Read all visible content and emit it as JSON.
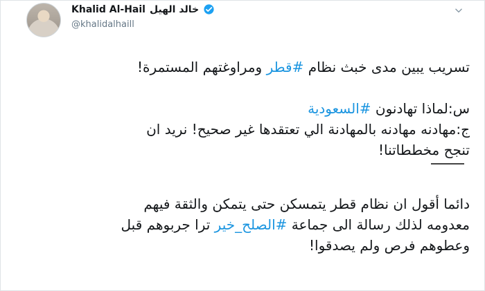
{
  "tweet": {
    "display_name": "Khalid Al-Hail",
    "arabic_name": "خالد الهيل",
    "handle": "@khalidalhaill",
    "verified_icon": "verified-badge-icon",
    "more_icon": "chevron-down-icon",
    "line1_pre": "تسريب يبين مدى خبث نظام ",
    "line1_tag": "#قطر",
    "line1_post": " ومراوغتهم المستمرة!",
    "q_pre": "س:لماذا تهادنون ",
    "q_tag": "#السعودية",
    "a_line1": "ج:مهادنه مهادنه بالمهادنة الي تعتقدها غير صحيح! نريد ان",
    "a_line2": "تنجح مخططاتنا!",
    "p3_line1": "دائما أقول ان نظام قطر يتمسكن حتى يتمكن والثقة فيهم",
    "p3_line2_pre": "معدومه لذلك رسالة الى جماعة ",
    "p3_tag": "#الصلح_خير",
    "p3_line2_post": " ترا جربوهم قبل",
    "p3_line3": "وعطوهم فرص ولم يصدقوا!"
  },
  "colors": {
    "link": "#1b95e0",
    "verified": "#1da1f2",
    "text": "#14171a",
    "muted": "#657786"
  }
}
